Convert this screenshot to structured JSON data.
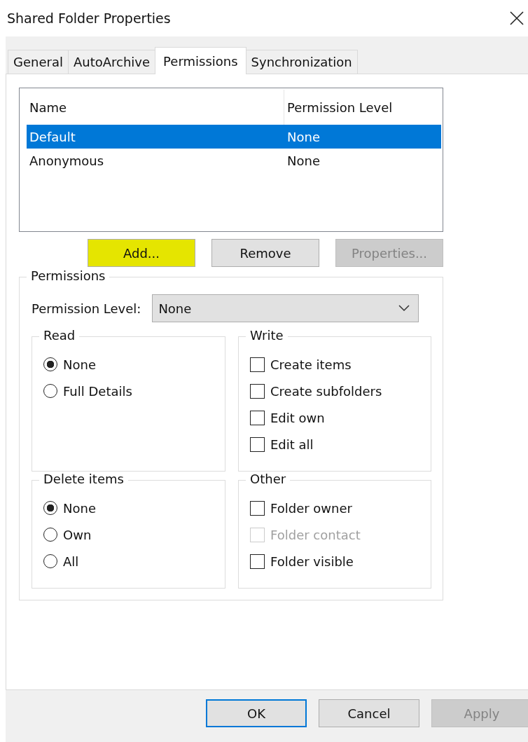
{
  "window": {
    "title": "Shared Folder Properties"
  },
  "tabs": [
    {
      "label": "General",
      "selected": false
    },
    {
      "label": "AutoArchive",
      "selected": false
    },
    {
      "label": "Permissions",
      "selected": true
    },
    {
      "label": "Synchronization",
      "selected": false
    }
  ],
  "users": {
    "columns": [
      "Name",
      "Permission Level"
    ],
    "rows": [
      {
        "cells": [
          "Default",
          "None"
        ],
        "selected": true
      },
      {
        "cells": [
          "Anonymous",
          "None"
        ],
        "selected": false
      }
    ]
  },
  "user_buttons": [
    {
      "label": "Add...",
      "disabled": false,
      "highlighted": true
    },
    {
      "label": "Remove",
      "disabled": false,
      "highlighted": false
    },
    {
      "label": "Properties...",
      "disabled": true,
      "highlighted": false
    }
  ],
  "permissions": {
    "title": "Permissions",
    "level_label": "Permission Level:",
    "level_value": "None",
    "groups": [
      {
        "title": "Read",
        "kind": "radio",
        "options": [
          {
            "label": "None",
            "selected": true,
            "disabled": false
          },
          {
            "label": "Full Details",
            "selected": false,
            "disabled": false
          }
        ]
      },
      {
        "title": "Write",
        "kind": "check",
        "options": [
          {
            "label": "Create items",
            "checked": false,
            "disabled": false
          },
          {
            "label": "Create subfolders",
            "checked": false,
            "disabled": false
          },
          {
            "label": "Edit own",
            "checked": false,
            "disabled": false
          },
          {
            "label": "Edit all",
            "checked": false,
            "disabled": false
          }
        ]
      },
      {
        "title": "Delete items",
        "kind": "radio",
        "options": [
          {
            "label": "None",
            "selected": true,
            "disabled": false
          },
          {
            "label": "Own",
            "selected": false,
            "disabled": false
          },
          {
            "label": "All",
            "selected": false,
            "disabled": false
          }
        ]
      },
      {
        "title": "Other",
        "kind": "check",
        "options": [
          {
            "label": "Folder owner",
            "checked": false,
            "disabled": false
          },
          {
            "label": "Folder contact",
            "checked": false,
            "disabled": true
          },
          {
            "label": "Folder visible",
            "checked": false,
            "disabled": false
          }
        ]
      }
    ]
  },
  "footer_buttons": [
    {
      "label": "OK",
      "default": true,
      "disabled": false
    },
    {
      "label": "Cancel",
      "default": false,
      "disabled": false
    },
    {
      "label": "Apply",
      "default": false,
      "disabled": true
    }
  ]
}
